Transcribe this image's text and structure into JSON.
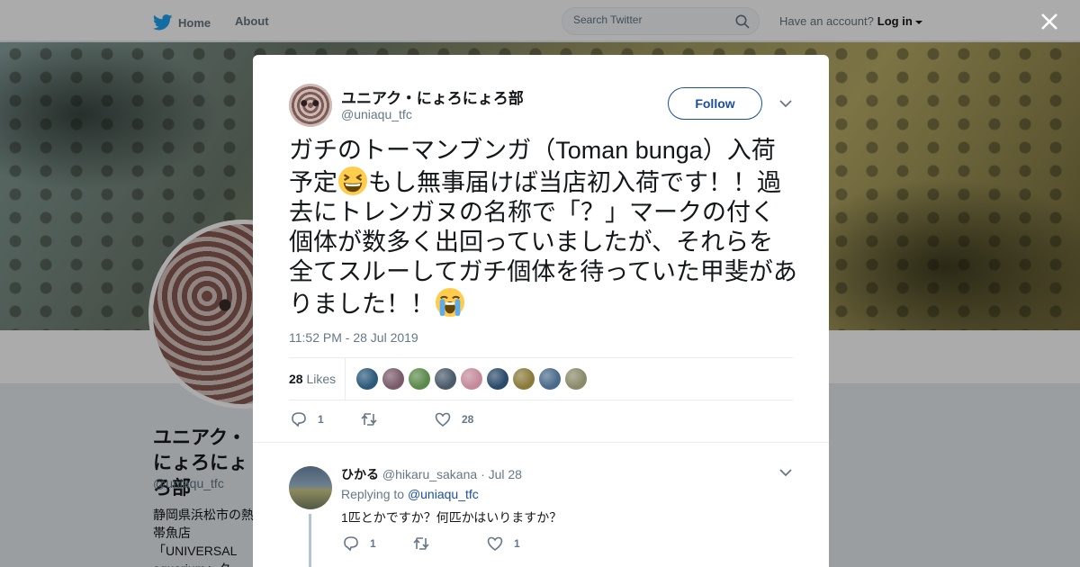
{
  "nav": {
    "home": "Home",
    "about": "About",
    "search_placeholder": "Search Twitter",
    "have_account": "Have an account?",
    "login": "Log in"
  },
  "background_profile": {
    "name": "ユニアク・にょろにょろ部",
    "handle": "@uniaqu_tfc",
    "bio": "静岡県浜松市の熱帯魚店「UNIVERSAL aquarium」ターではポリプ・ニョロニョロ系熱帯魚"
  },
  "tweet": {
    "author_name": "ユニアク・にょろにょろ部",
    "author_handle": "@uniaqu_tfc",
    "follow_label": "Follow",
    "text_part1": "ガチのトーマンブンガ（Toman bunga）入荷予定",
    "text_part2": "もし無事届けば当店初入荷です！！過去にトレンガヌの名称で「？」マークの付く個体が数多く出回っていましたが、それらを全てスルーしてガチ個体を待っていた甲斐がありました！！",
    "emoji1": "grinning-squinting-face",
    "emoji2": "loudly-crying-face",
    "timestamp": "11:52 PM - 28 Jul 2019",
    "likes_count": "28",
    "likes_label": "Likes",
    "likers": [
      "#2b5a7a",
      "#7a5a6a",
      "#5a8a4a",
      "#4a5a6a",
      "#c48a9a",
      "#2a4a6a",
      "#8a7a3a",
      "#4a6a8a",
      "#8a8a6a"
    ],
    "reply_count": "1",
    "retweet_count": "",
    "like_count": "28"
  },
  "reply": {
    "author_name": "ひかる",
    "author_handle": "@hikaru_sakana",
    "date": "· Jul 28",
    "replying_to_label": "Replying to",
    "replying_to_handle": "@uniaqu_tfc",
    "text": "1匹とかですか？何匹かはいりますか？",
    "reply_count": "1",
    "retweet_count": "",
    "like_count": "1"
  },
  "colors": {
    "accent": "#1c4e9b",
    "twitter_blue": "#1da1f2",
    "muted": "#657786"
  }
}
